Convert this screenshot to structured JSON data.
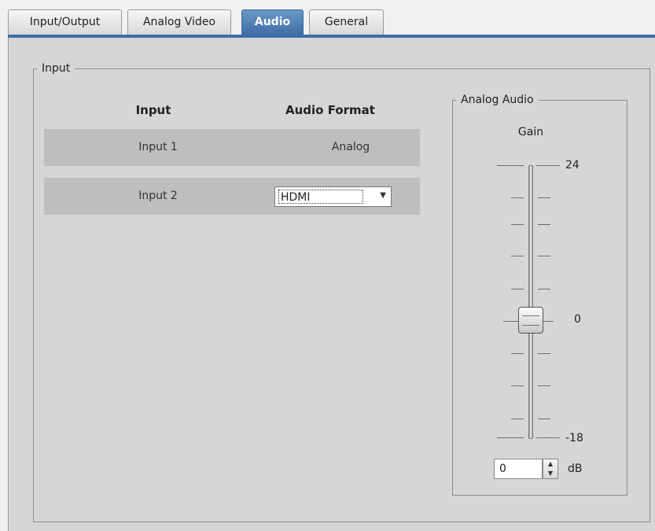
{
  "tabs": [
    {
      "label": "Input/Output"
    },
    {
      "label": "Analog Video"
    },
    {
      "label": "Audio",
      "active": true
    },
    {
      "label": "General"
    }
  ],
  "colors": {
    "accent": "#3e6ea6",
    "panel_bg": "#d6d6d6",
    "row_bg": "#bebebe"
  },
  "input_group": {
    "legend": "Input",
    "col_input": "Input",
    "col_format": "Audio Format",
    "rows": [
      {
        "input": "Input 1",
        "format": "Analog"
      },
      {
        "input": "Input 2",
        "format_select": "HDMI"
      }
    ]
  },
  "analog_audio": {
    "legend": "Analog Audio",
    "gain_label": "Gain",
    "scale_max": "24",
    "scale_mid": "0",
    "scale_min": "-18",
    "gain_value": "0",
    "unit": "dB",
    "icons": {
      "spin_up": "spin-up-icon",
      "spin_down": "spin-down-icon",
      "dropdown": "chevron-down-icon"
    }
  }
}
